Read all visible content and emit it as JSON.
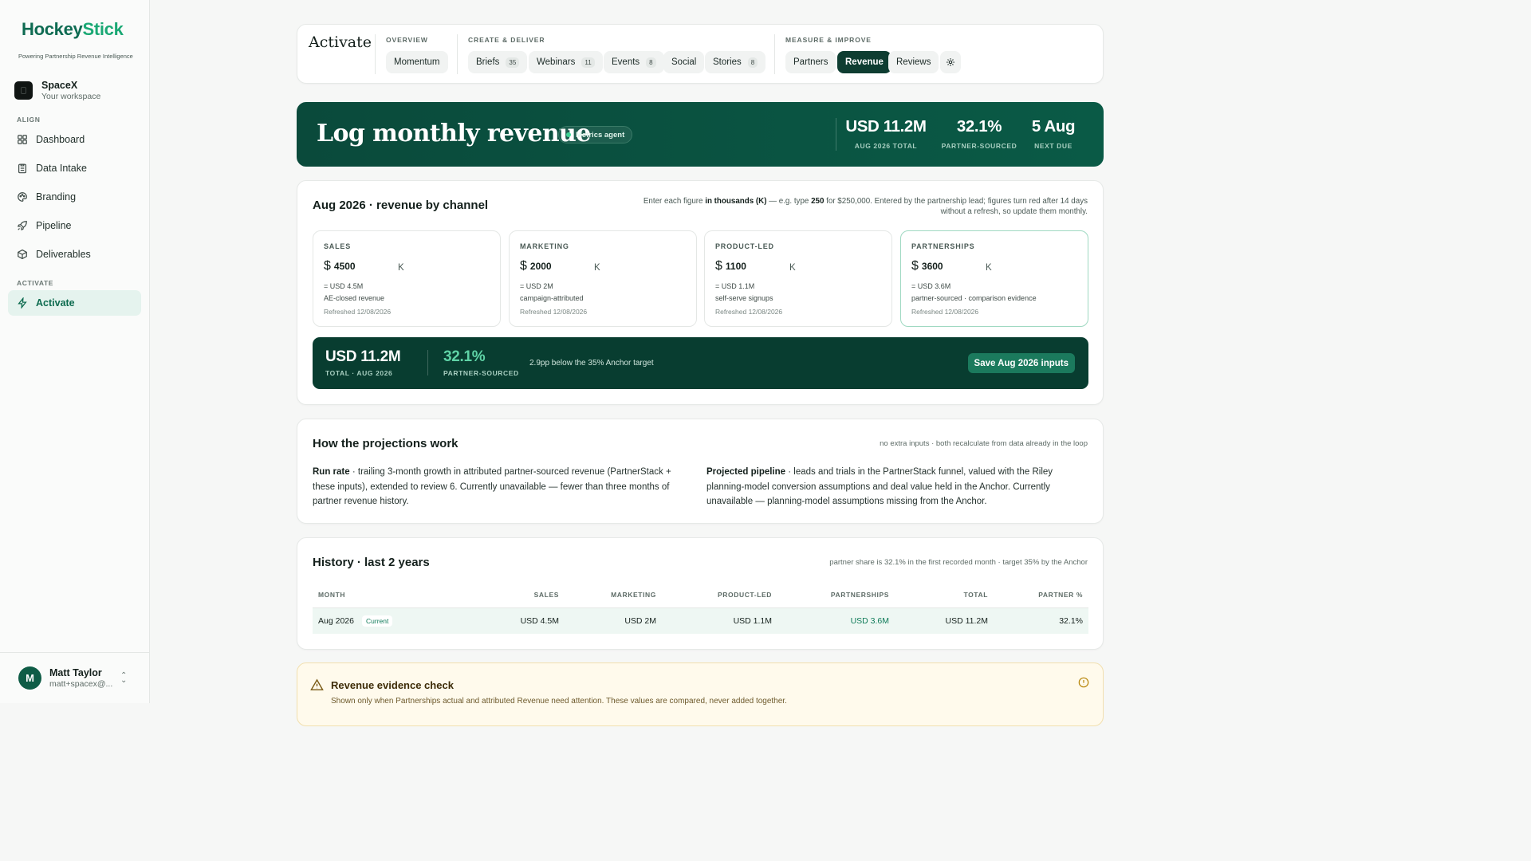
{
  "brand": {
    "logo_main": "Hockey",
    "logo_accent": "Stick",
    "tagline": "Powering Partnership Revenue Intelligence"
  },
  "workspace": {
    "name": "SpaceX",
    "sub": "Your workspace"
  },
  "sidebar": {
    "section_align": "ALIGN",
    "section_activate": "ACTIVATE",
    "items": [
      {
        "label": "Dashboard",
        "icon": "dashboard-icon"
      },
      {
        "label": "Data Intake",
        "icon": "clipboard-icon"
      },
      {
        "label": "Branding",
        "icon": "palette-icon"
      },
      {
        "label": "Pipeline",
        "icon": "rocket-icon"
      },
      {
        "label": "Deliverables",
        "icon": "package-icon"
      },
      {
        "label": "Activate",
        "icon": "lightning-icon",
        "active": true
      }
    ]
  },
  "user": {
    "initial": "M",
    "name": "Matt Taylor",
    "email": "matt+spacex@..."
  },
  "topnav": {
    "title": "Activate",
    "groups": {
      "overview": "OVERVIEW",
      "create": "CREATE & DELIVER",
      "measure": "MEASURE & IMPROVE"
    },
    "momentum": "Momentum",
    "briefs": {
      "label": "Briefs",
      "count": "35"
    },
    "webinars": {
      "label": "Webinars",
      "count": "11"
    },
    "events": {
      "label": "Events",
      "count": "8"
    },
    "social": "Social",
    "stories": {
      "label": "Stories",
      "count": "8"
    },
    "partners": "Partners",
    "revenue": "Revenue",
    "reviews": "Reviews"
  },
  "banner": {
    "title": "Log monthly revenue",
    "agent": "Metrics agent",
    "metrics": [
      {
        "value": "USD 11.2M",
        "label": "AUG 2026 TOTAL"
      },
      {
        "value": "32.1%",
        "label": "PARTNER-SOURCED"
      },
      {
        "value": "5 Aug",
        "label": "NEXT DUE"
      }
    ]
  },
  "revenue": {
    "title": "Aug 2026 · revenue by channel",
    "note_pre": "Enter each figure ",
    "note_bold1": "in thousands (K)",
    "note_mid": " — e.g. type ",
    "note_bold2": "250",
    "note_post": " for $250,000. Entered by the partnership lead; figures turn red after 14 days without a refresh, so update them monthly.",
    "channels": [
      {
        "label": "SALES",
        "value": "4500",
        "usd": "= USD 4.5M",
        "desc": "AE-closed revenue",
        "refreshed": "Refreshed 12/08/2026"
      },
      {
        "label": "MARKETING",
        "value": "2000",
        "usd": "= USD 2M",
        "desc": "campaign-attributed",
        "refreshed": "Refreshed 12/08/2026"
      },
      {
        "label": "PRODUCT-LED",
        "value": "1100",
        "usd": "= USD 1.1M",
        "desc": "self-serve signups",
        "refreshed": "Refreshed 12/08/2026"
      },
      {
        "label": "PARTNERSHIPS",
        "value": "3600",
        "usd": "= USD 3.6M",
        "desc": "partner-sourced · comparison evidence",
        "refreshed": "Refreshed 12/08/2026"
      }
    ],
    "currency_symbol": "$",
    "unit": "K",
    "total": {
      "value": "USD 11.2M",
      "label": "TOTAL · AUG 2026"
    },
    "share": {
      "value": "32.1%",
      "label": "PARTNER-SOURCED"
    },
    "target_note": "2.9pp below the 35% Anchor target",
    "save_label": "Save Aug 2026 inputs"
  },
  "projections": {
    "title": "How the projections work",
    "note": "no extra inputs · both recalculate from data already in the loop",
    "run_rate_label": "Run rate",
    "run_rate_text": " · trailing 3-month growth in attributed partner-sourced revenue (PartnerStack + these inputs), extended to review 6. Currently unavailable — fewer than three months of partner revenue history.",
    "pipeline_label": "Projected pipeline",
    "pipeline_text": " · leads and trials in the PartnerStack funnel, valued with the Riley planning-model conversion assumptions and deal value held in the Anchor. Currently unavailable — planning-model assumptions missing from the Anchor."
  },
  "history": {
    "title": "History · last 2 years",
    "note": "partner share is 32.1% in the first recorded month · target 35% by the Anchor",
    "columns": [
      "MONTH",
      "SALES",
      "MARKETING",
      "PRODUCT-LED",
      "PARTNERSHIPS",
      "TOTAL",
      "PARTNER %"
    ],
    "rows": [
      {
        "month": "Aug 2026",
        "badge": "Current",
        "sales": "USD 4.5M",
        "marketing": "USD 2M",
        "product": "USD 1.1M",
        "partnerships": "USD 3.6M",
        "total": "USD 11.2M",
        "partner_pct": "32.1%"
      }
    ]
  },
  "evidence": {
    "title": "Revenue evidence check",
    "sub": "Shown only when Partnerships actual and attributed Revenue need attention. These values are compared, never added together."
  },
  "colors": {
    "brand_dark": "#0a4a3b",
    "accent": "#1aa874",
    "active_nav_bg": "#e5f3ee"
  }
}
